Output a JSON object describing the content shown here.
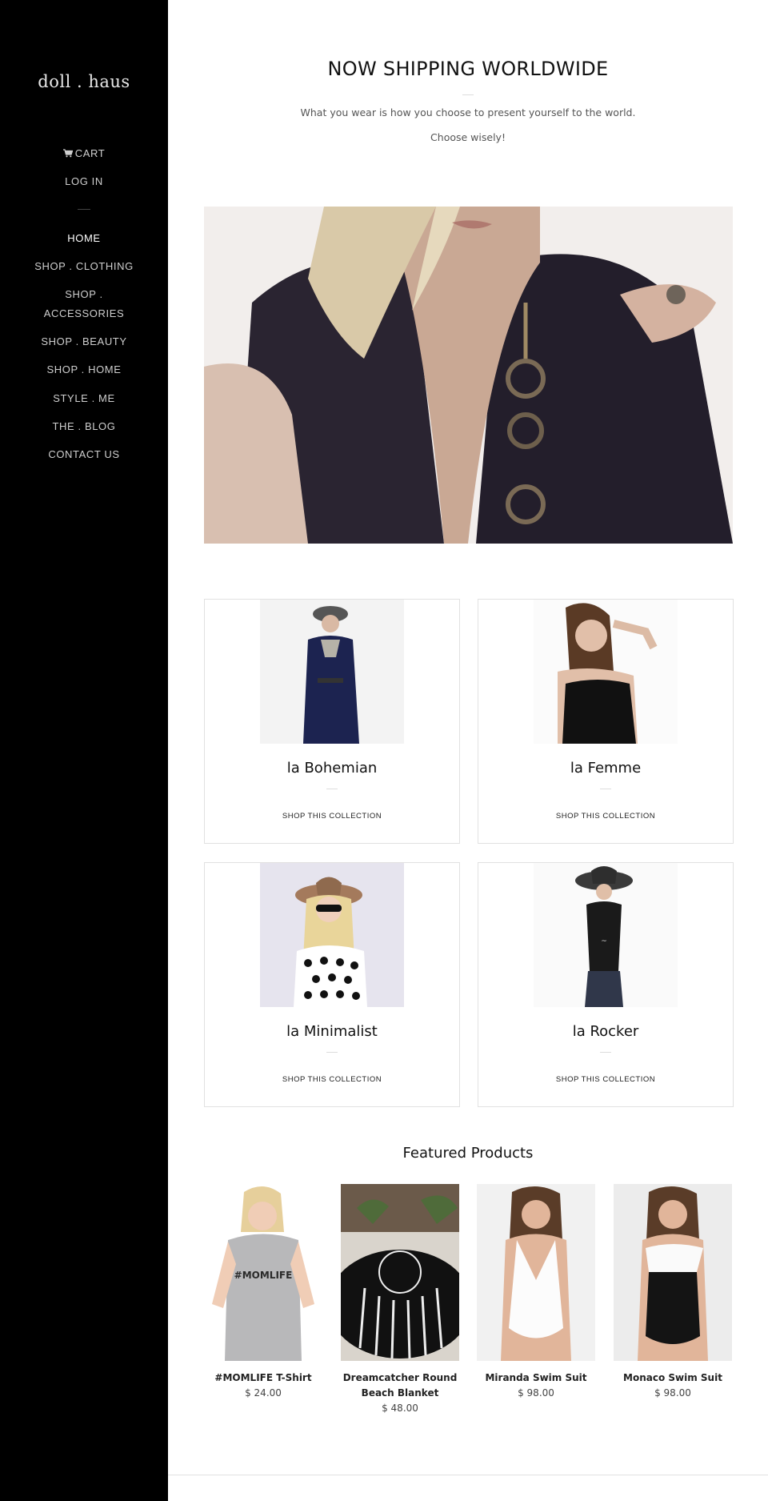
{
  "brand": {
    "logo": "doll . haus"
  },
  "sidebar": {
    "cart_label": "CART",
    "login_label": "LOG IN",
    "nav": [
      {
        "label": "HOME",
        "active": true
      },
      {
        "label": "SHOP . CLOTHING"
      },
      {
        "label_line1": "SHOP .",
        "label_line2": "ACCESSORIES"
      },
      {
        "label": "SHOP . BEAUTY"
      },
      {
        "label": "SHOP . HOME"
      },
      {
        "label": "STYLE . ME"
      },
      {
        "label": "THE . BLOG"
      },
      {
        "label": "CONTACT US"
      }
    ]
  },
  "hero": {
    "headline": "NOW SHIPPING WORLDWIDE",
    "subtext_line1": "What you wear is how you choose to present yourself to the world.",
    "subtext_line2": "Choose wisely!"
  },
  "collections": [
    {
      "title": "la Bohemian",
      "link": "SHOP THIS COLLECTION"
    },
    {
      "title": "la Femme",
      "link": "SHOP THIS COLLECTION"
    },
    {
      "title": "la Minimalist",
      "link": "SHOP THIS COLLECTION"
    },
    {
      "title": "la Rocker",
      "link": "SHOP THIS COLLECTION"
    }
  ],
  "featured": {
    "title": "Featured Products",
    "products": [
      {
        "name": "#MOMLIFE T-Shirt",
        "price": "$ 24.00",
        "print": "#MOMLIFE"
      },
      {
        "name_line1": "Dreamcatcher Round",
        "name_line2": "Beach Blanket",
        "price": "$ 48.00"
      },
      {
        "name": "Miranda Swim Suit",
        "price": "$ 98.00"
      },
      {
        "name": "Monaco Swim Suit",
        "price": "$ 98.00"
      }
    ]
  },
  "colors": {
    "sidebar_bg": "#000000",
    "text": "#111111",
    "border": "#e1e1e1"
  }
}
